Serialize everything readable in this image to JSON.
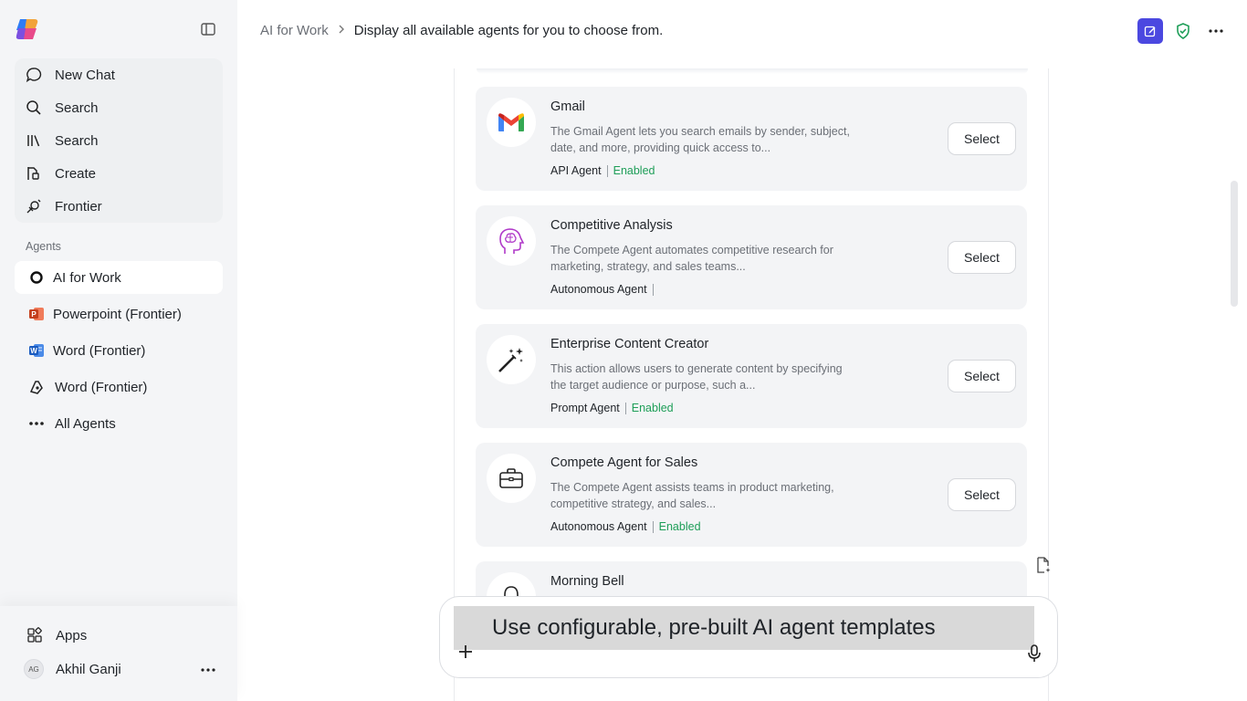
{
  "sidebar": {
    "nav": [
      {
        "label": "New Chat",
        "icon": "chat-bubble-icon"
      },
      {
        "label": "Search",
        "icon": "search-icon"
      },
      {
        "label": "Search",
        "icon": "library-icon"
      },
      {
        "label": "Create",
        "icon": "create-icon"
      },
      {
        "label": "Frontier",
        "icon": "frontier-icon"
      }
    ],
    "agents_label": "Agents",
    "agents": [
      {
        "label": "AI for Work",
        "icon": "ring-icon"
      },
      {
        "label": "Powerpoint (Frontier)",
        "icon": "powerpoint-icon"
      },
      {
        "label": "Word (Frontier)",
        "icon": "word-icon"
      },
      {
        "label": "Word (Frontier)",
        "icon": "pen-nib-icon"
      },
      {
        "label": "All Agents",
        "icon": "ellipsis-icon"
      }
    ],
    "apps_label": "Apps",
    "user": {
      "initials": "AG",
      "name": "Akhil Ganji"
    }
  },
  "header": {
    "breadcrumb_root": "AI for Work",
    "breadcrumb_separator": ">",
    "breadcrumb_current": "Display all available agents for you to choose from."
  },
  "cards": [
    {
      "title": "Gmail",
      "description": "The Gmail Agent lets you search emails by sender, subject, date, and more, providing quick access to...",
      "type": "API Agent",
      "status": "Enabled",
      "icon": "gmail-icon",
      "button": "Select"
    },
    {
      "title": "Competitive Analysis",
      "description": "The Compete Agent automates competitive research for marketing, strategy, and sales teams...",
      "type": "Autonomous Agent",
      "status": "",
      "icon": "brain-head-icon",
      "button": "Select"
    },
    {
      "title": "Enterprise Content Creator",
      "description": "This action allows users to generate content by specifying the target audience or purpose, such a...",
      "type": "Prompt Agent",
      "status": "Enabled",
      "icon": "magic-wand-icon",
      "button": "Select"
    },
    {
      "title": "Compete Agent for Sales",
      "description": "The Compete Agent assists teams in product marketing, competitive strategy, and sales...",
      "type": "Autonomous Agent",
      "status": "Enabled",
      "icon": "briefcase-icon",
      "button": "Select"
    },
    {
      "title": "Morning Bell",
      "description": "",
      "type": "",
      "status": "",
      "icon": "bell-icon",
      "button": ""
    }
  ],
  "composer": {
    "suggestion": "Use configurable, pre-built AI agent templates"
  },
  "colors": {
    "accent": "#4b48e0",
    "enabled": "#1e9e58",
    "sidebar_bg": "#f4f5f7",
    "card_bg": "#f3f4f6"
  }
}
